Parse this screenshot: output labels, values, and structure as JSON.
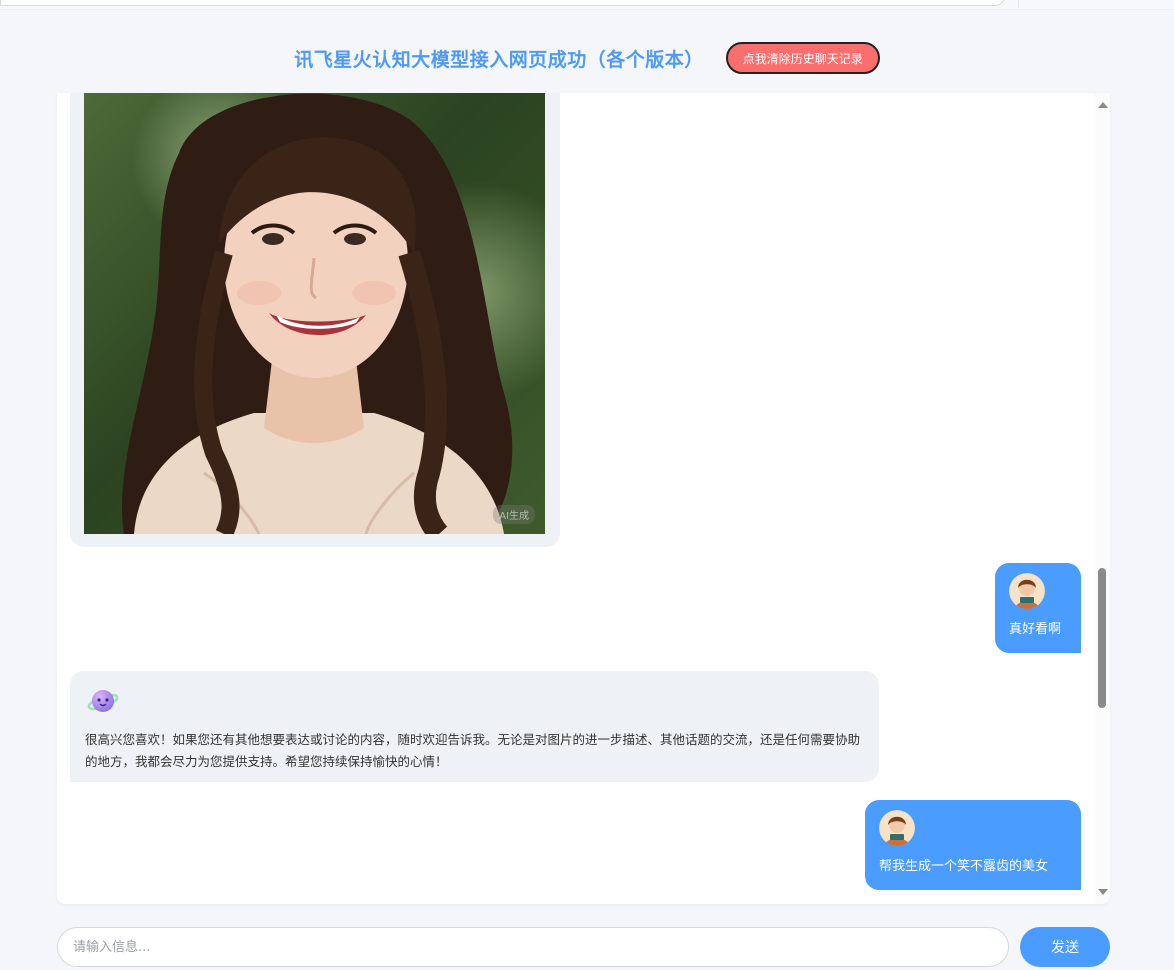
{
  "header": {
    "title": "讯飞星火认知大模型接入网页成功（各个版本）",
    "clear_button_label": "点我清除历史聊天记录"
  },
  "messages": [
    {
      "role": "assistant",
      "type": "image",
      "watermark": "AI生成"
    },
    {
      "role": "user",
      "text": "真好看啊"
    },
    {
      "role": "assistant",
      "text": "很高兴您喜欢！如果您还有其他想要表达或讨论的内容，随时欢迎告诉我。无论是对图片的进一步描述、其他话题的交流，还是任何需要协助的地方，我都会尽力为您提供支持。希望您持续保持愉快的心情！"
    },
    {
      "role": "user",
      "text": "帮我生成一个笑不露齿的美女"
    }
  ],
  "composer": {
    "placeholder": "请输入信息...",
    "value": "",
    "send_label": "发送"
  },
  "colors": {
    "accent": "#4a9dff",
    "title": "#4f9bf2",
    "danger": "#fb6e6e",
    "ai_bubble": "#eef1f5"
  },
  "icons": {
    "user_avatar": "user-avatar-icon",
    "assistant_avatar": "spark-assistant-icon"
  }
}
